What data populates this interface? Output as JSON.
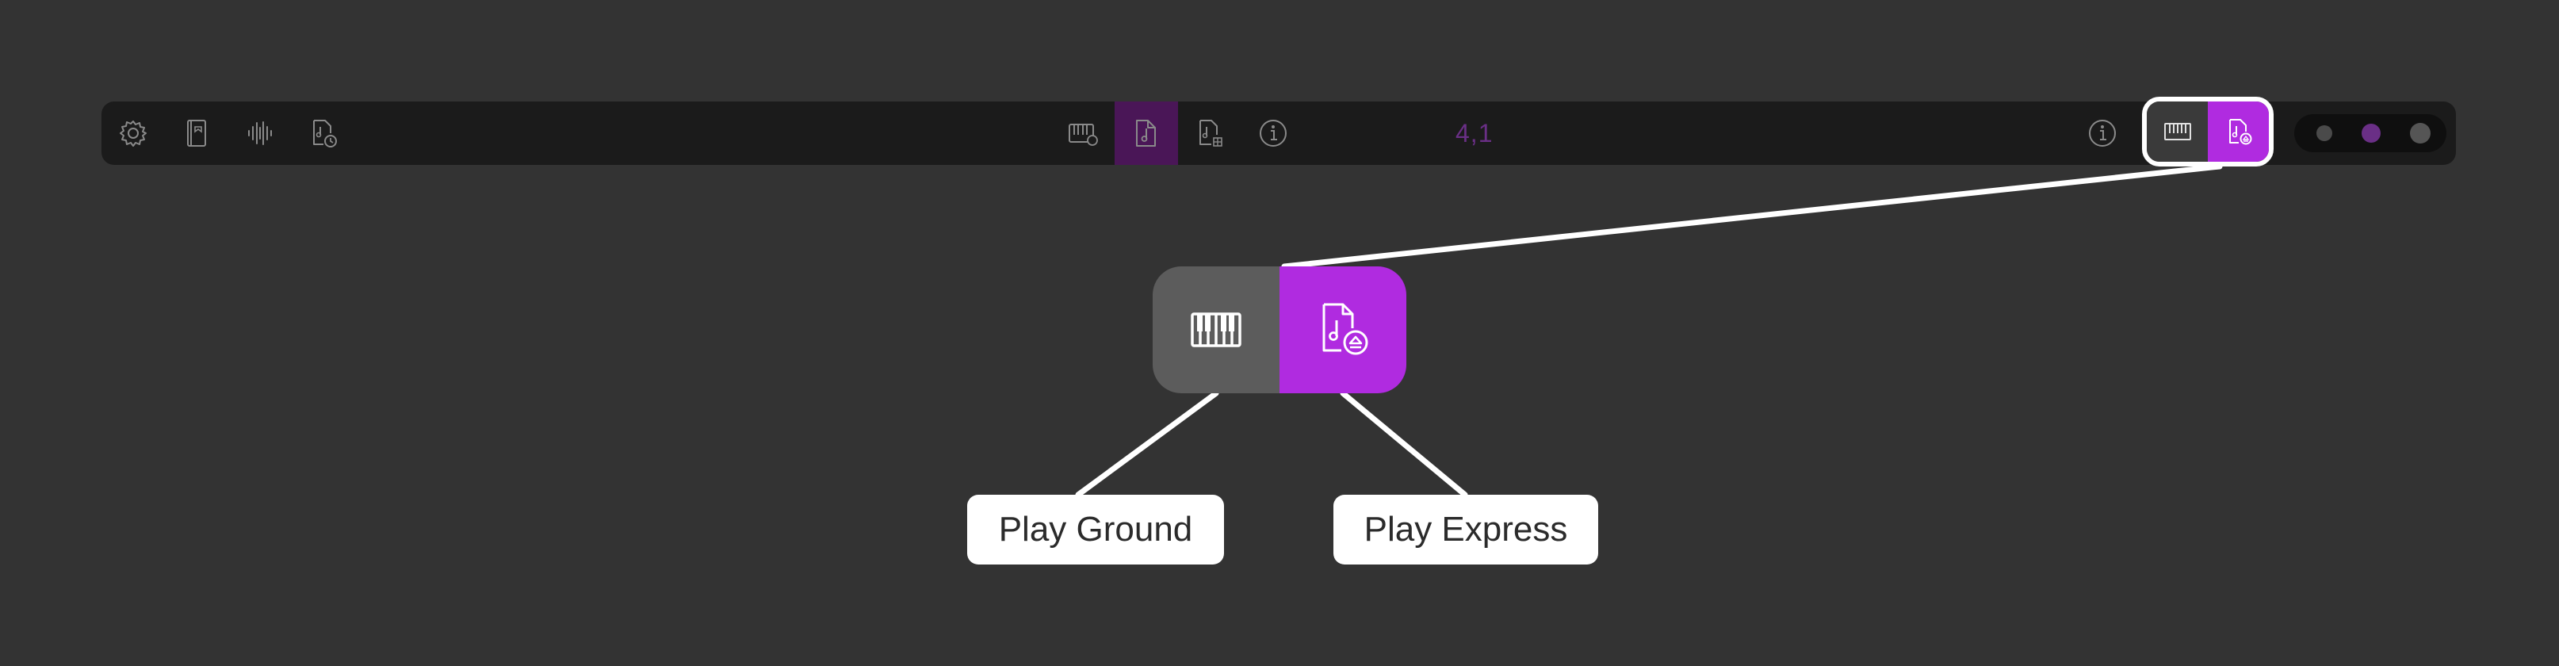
{
  "colors": {
    "background": "#333333",
    "toolbar": "#1b1b1b",
    "accent": "#b02be0",
    "accent_dark": "#4a1657",
    "icon_gray": "#8a8a8a",
    "callout_text": "#2b2b2b",
    "toggle_gray": "#5c5c5c"
  },
  "toolbar": {
    "left_icons": [
      "gear-icon",
      "book-icon",
      "waveform-icon",
      "file-clock-icon"
    ],
    "center_icons": [
      "keyboard-icon",
      "music-file-icon",
      "music-file-grid-icon",
      "info-icon"
    ],
    "active_center": "music-file-icon",
    "position_readout": "4,1",
    "right_info_icon": "info-icon"
  },
  "mode_toggle": {
    "options": [
      {
        "id": "play-ground",
        "icon": "keyboard-icon",
        "selected": false
      },
      {
        "id": "play-express",
        "icon": "music-file-eject-icon",
        "selected": true
      }
    ]
  },
  "dots": [
    "inactive",
    "active",
    "inactive"
  ],
  "callouts": {
    "left": "Play Ground",
    "right": "Play Express"
  }
}
